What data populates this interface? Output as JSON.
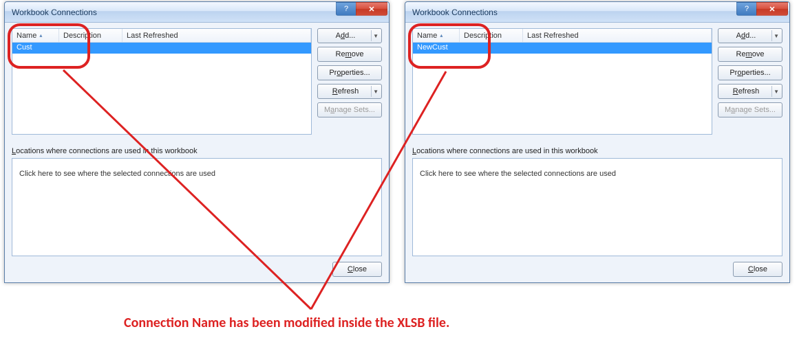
{
  "dialogs": [
    {
      "title": "Workbook Connections",
      "columns": {
        "name": "Name",
        "description": "Description",
        "refreshed": "Last Refreshed"
      },
      "row_label": "Cust",
      "buttons": {
        "add": "Add...",
        "remove": "Remove",
        "properties": "Properties...",
        "refresh": "Refresh",
        "manage": "Manage Sets..."
      },
      "locations_label_pre": "L",
      "locations_label_rest": "ocations where connections are used in this workbook",
      "locations_text": "Click here to see where the selected connections are used",
      "close": "Close"
    },
    {
      "title": "Workbook Connections",
      "columns": {
        "name": "Name",
        "description": "Description",
        "refreshed": "Last Refreshed"
      },
      "row_label": "NewCust",
      "buttons": {
        "add": "Add...",
        "remove": "Remove",
        "properties": "Properties...",
        "refresh": "Refresh",
        "manage": "Manage Sets..."
      },
      "locations_label_pre": "L",
      "locations_label_rest": "ocations where connections are used in this workbook",
      "locations_text": "Click here to see where the selected connections are used",
      "close": "Close"
    }
  ],
  "annotation": "Connection Name has been modified inside the XLSB file.",
  "title_buttons": {
    "help": "?",
    "close": "✕"
  }
}
